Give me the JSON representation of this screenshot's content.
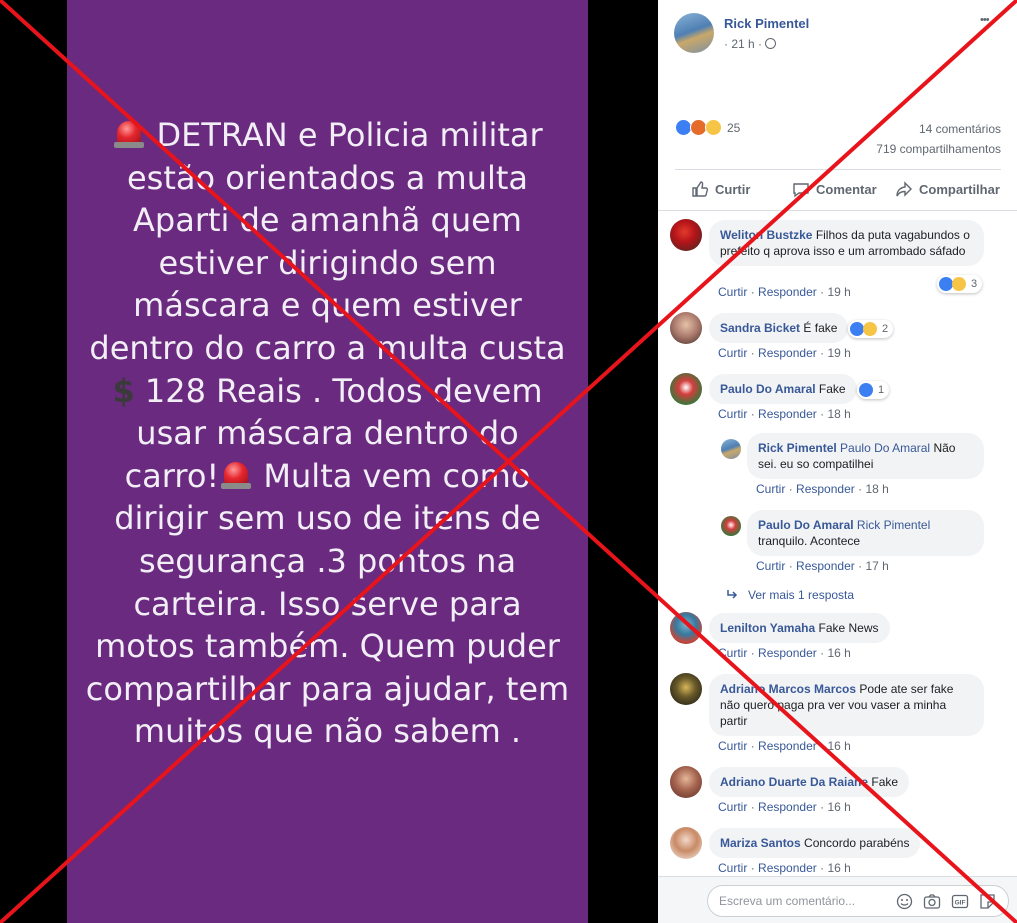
{
  "post": {
    "lines": [
      "DETRAN e Policia militar",
      "estão orientados a multa",
      "Aparti de amanhã quem",
      "estiver dirigindo sem",
      "máscara e quem estiver",
      "dentro do carro a multa custa",
      "128 Reais . Todos devem",
      "usar máscara dentro do",
      "Multa vem como",
      "dirigir sem uso de itens de",
      "segurança .3 pontos na",
      "carteira. Isso serve para",
      "motos também.  Quem puder",
      "compartilhar para ajudar, tem",
      "muitos que não sabem ."
    ],
    "line9_prefix": "carro!"
  },
  "header": {
    "author": "Rick Pimentel",
    "time": "21 h",
    "dot": "·",
    "more": "•••"
  },
  "stats": {
    "reaction_count": "25",
    "comments": "14 comentários",
    "shares": "719 compartilhamentos"
  },
  "actions": {
    "like": "Curtir",
    "comment": "Comentar",
    "share": "Compartilhar"
  },
  "comments": [
    {
      "name": "Weliton Bustzke",
      "text": "Filhos da puta vagabundos o prefeito q aprova isso e um arrombado sáfado",
      "like": "Curtir",
      "reply": "Responder",
      "time": "19 h",
      "reactions": "3"
    },
    {
      "name": "Sandra Bicket",
      "text": "É fake",
      "like": "Curtir",
      "reply": "Responder",
      "time": "19 h",
      "reactions": "2"
    },
    {
      "name": "Paulo Do Amaral",
      "text": "Fake",
      "like": "Curtir",
      "reply": "Responder",
      "time": "18 h",
      "reactions": "1"
    },
    {
      "name": "Rick Pimentel",
      "tag": "Paulo Do Amaral",
      "text": "Não sei. eu so compatilhei",
      "like": "Curtir",
      "reply": "Responder",
      "time": "18 h"
    },
    {
      "name": "Paulo Do Amaral",
      "tag": "Rick Pimentel",
      "text": "tranquilo. Acontece",
      "like": "Curtir",
      "reply": "Responder",
      "time": "17 h"
    },
    {
      "name": "Lenilton Yamaha",
      "text": "Fake News",
      "like": "Curtir",
      "reply": "Responder",
      "time": "16 h"
    },
    {
      "name": "Adriano Marcos Marcos",
      "text": "Pode ate ser fake não quero paga pra ver vou vaser a minha partir",
      "like": "Curtir",
      "reply": "Responder",
      "time": "16 h"
    },
    {
      "name": "Adriano Duarte Da Raiane",
      "text": "Fake",
      "like": "Curtir",
      "reply": "Responder",
      "time": "16 h"
    },
    {
      "name": "Mariza Santos",
      "text": "Concordo parabéns",
      "like": "Curtir",
      "reply": "Responder",
      "time": "16 h"
    }
  ],
  "more_replies": "Ver mais 1 resposta",
  "composer": {
    "placeholder": "Escreva um comentário..."
  },
  "colors": {
    "purple": "#6a2a80",
    "fb_blue": "#385898",
    "cross_red": "#e8141b"
  },
  "icons": [
    "like-icon",
    "comment-icon",
    "share-icon",
    "globe-icon",
    "reply-arrow-icon",
    "emoji-icon",
    "camera-icon",
    "gif-icon",
    "sticker-icon",
    "siren-icon",
    "dollar-icon"
  ]
}
